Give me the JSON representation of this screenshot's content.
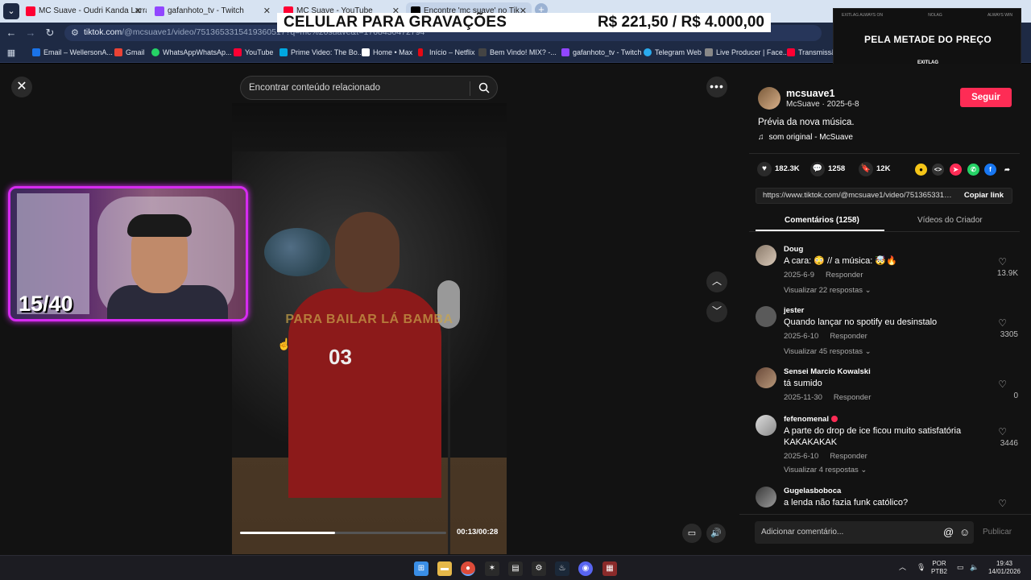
{
  "browser": {
    "tabs": [
      {
        "title": "MC Suave - Oudri Kanda Larra",
        "color": "#ff0033"
      },
      {
        "title": "gafanhoto_tv - Twitch",
        "color": "#9146ff"
      },
      {
        "title": "MC Suave - YouTube",
        "color": "#ff0033"
      },
      {
        "title": "Encontre 'mc suave' no Tik",
        "color": "#000000"
      }
    ],
    "url_host": "tiktok.com",
    "url_path": "/@mcsuave1/video/7513653315419360517?q=mc%20suave&t=1768430472794",
    "bookmarks": [
      {
        "label": "Email – WellersonA...",
        "color": "#1a73e8"
      },
      {
        "label": "Gmail",
        "color": "#ea4335"
      },
      {
        "label": "WhatsAppWhatsAp...",
        "color": "#25d366"
      },
      {
        "label": "YouTube",
        "color": "#ff0033"
      },
      {
        "label": "Prime Video: The Bo...",
        "color": "#00a8e1"
      },
      {
        "label": "Home • Max",
        "color": "#ffffff"
      },
      {
        "label": "Início – Netflix",
        "color": "#e50914"
      },
      {
        "label": "Bem Vindo! MIX? -...",
        "color": "#444444"
      },
      {
        "label": "gafanhoto_tv - Twitch",
        "color": "#9146ff"
      },
      {
        "label": "Telegram Web",
        "color": "#2aabee"
      },
      {
        "label": "Live Producer | Face...",
        "color": "#888888"
      },
      {
        "label": "Transmissão",
        "color": "#ff0033"
      }
    ]
  },
  "overlay": {
    "promo_left": "CELULAR PARA GRAVAÇÕES",
    "promo_right": "R$ 221,50 / R$ 4.000,00",
    "ad_top": [
      "EXITLAG ALWAYS ON",
      "NOLAG",
      "ALWAYS WIN"
    ],
    "ad_main": "PELA METADE DO PREÇO",
    "ad_logo": "EXITLAG",
    "webcam_counter": "15/40"
  },
  "player": {
    "search_placeholder": "Encontrar conteúdo relacionado",
    "video_caption": "PARA BAILAR LÁ BAMBA",
    "shirt_number": "03",
    "time": "00:13/00:28",
    "progress_fraction": 0.46
  },
  "creator": {
    "username": "mcsuave1",
    "subline": "McSuave · 2025-6-8",
    "follow_label": "Seguir",
    "description": "Prévia da nova música.",
    "sound": "som original - McSuave"
  },
  "stats": {
    "likes": "182.3K",
    "comments": "1258",
    "saves": "12K"
  },
  "share_icons": [
    "coin-icon",
    "embed-icon",
    "paper-plane-icon",
    "whatsapp-icon",
    "facebook-icon",
    "share-arrow-icon"
  ],
  "link": {
    "url": "https://www.tiktok.com/@mcsuave1/video/7513653315419360517?q=mc%20suave&t=1768430472794",
    "copy_label": "Copiar link"
  },
  "panel_tabs": {
    "comments": "Comentários (1258)",
    "creator_videos": "Vídeos do Criador"
  },
  "comments": [
    {
      "name": "Doug",
      "text": "A cara: 😳 // a música: 🤯🔥",
      "date": "2025-6-9",
      "reply": "Responder",
      "more": "Visualizar 22 respostas ⌄",
      "likes": "13.9K"
    },
    {
      "name": "jester",
      "text": "Quando lançar no spotify eu desinstalo",
      "date": "2025-6-10",
      "reply": "Responder",
      "more": "Visualizar 45 respostas ⌄",
      "likes": "3305"
    },
    {
      "name": "Sensei Marcio Kowalski",
      "text": "tá sumido",
      "date": "2025-11-30",
      "reply": "Responder",
      "more": "",
      "likes": "0"
    },
    {
      "name": "fefenomenal",
      "text": "A parte do drop de ice ficou muito satisfatória KAKAKAKAK",
      "date": "2025-6-10",
      "reply": "Responder",
      "more": "Visualizar 4 respostas ⌄",
      "likes": "3446"
    },
    {
      "name": "Gugelasboboca",
      "text": "a lenda não fazia funk católico?",
      "date": "",
      "reply": "",
      "more": "",
      "likes": ""
    }
  ],
  "compose": {
    "placeholder": "Adicionar comentário...",
    "publish": "Publicar"
  },
  "taskbar": {
    "lang_top": "POR",
    "lang_bottom": "PTB2",
    "time": "19:43",
    "date": "14/01/2026"
  }
}
